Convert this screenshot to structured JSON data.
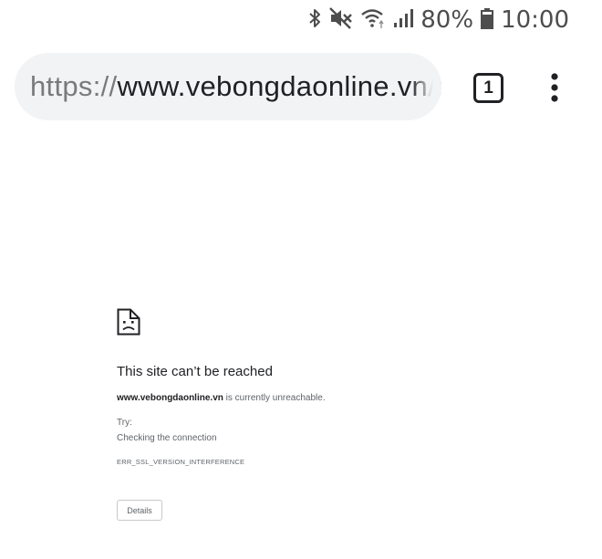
{
  "status_bar": {
    "battery_percent": "80%",
    "time": "10:00",
    "icons": [
      "bluetooth-icon",
      "mute-icon",
      "wifi-icon",
      "signal-icon",
      "battery-icon"
    ]
  },
  "toolbar": {
    "url_scheme": "https://",
    "url_host": "www.vebongdaonline.vn",
    "url_rest": "/c",
    "tab_count": "1",
    "menu_icon": "more-vert-icon"
  },
  "error_page": {
    "icon": "sad-page-icon",
    "title": "This site can’t be reached",
    "host": "www.vebongdaonline.vn",
    "description_suffix": " is currently unreachable.",
    "try_label": "Try:",
    "suggestion": "Checking the connection",
    "error_code": "ERR_SSL_VERSION_INTERFERENCE",
    "details_label": "Details"
  },
  "colors": {
    "omnibox_bg": "#f1f3f4",
    "text_primary": "#202124",
    "text_secondary": "#5f6368"
  }
}
